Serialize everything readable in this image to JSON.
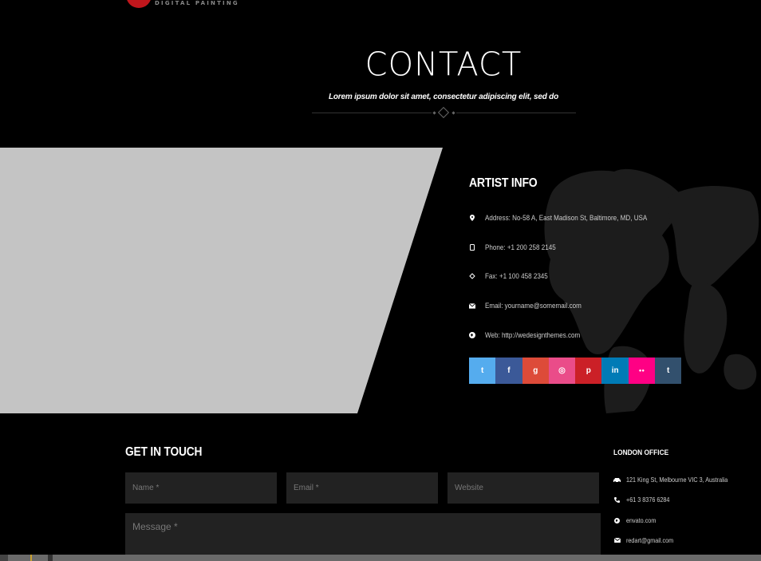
{
  "logo": {
    "subtitle": "DIGITAL PAINTING"
  },
  "header": {
    "title": "CONTACT",
    "subtitle": "Lorem ipsum dolor sit amet, consectetur adipiscing elit, sed do"
  },
  "artist_info": {
    "title": "ARTIST INFO",
    "items": [
      {
        "icon": "map-marker-icon",
        "text": "Address: No-58 A, East Madison St, Baltimore, MD, USA"
      },
      {
        "icon": "phone-icon",
        "text": "Phone: +1 200 258 2145"
      },
      {
        "icon": "fax-icon",
        "text": "Fax: +1 100 458 2345"
      },
      {
        "icon": "envelope-icon",
        "text": "Email: yourname@somemail.com"
      },
      {
        "icon": "globe-icon",
        "text": "Web: http://wedesignthemes.com"
      }
    ],
    "social": [
      {
        "name": "twitter",
        "glyph": "t",
        "color": "#55acee"
      },
      {
        "name": "facebook",
        "glyph": "f",
        "color": "#3b5998"
      },
      {
        "name": "google-plus",
        "glyph": "g",
        "color": "#dd4b39"
      },
      {
        "name": "dribbble",
        "glyph": "◎",
        "color": "#ea4c89"
      },
      {
        "name": "pinterest",
        "glyph": "p",
        "color": "#cb2027"
      },
      {
        "name": "linkedin",
        "glyph": "in",
        "color": "#007bb6"
      },
      {
        "name": "flickr",
        "glyph": "●●",
        "color": "#ff0084"
      },
      {
        "name": "tumblr",
        "glyph": "t",
        "color": "#32506d"
      }
    ]
  },
  "form": {
    "title": "GET IN TOUCH",
    "name_placeholder": "Name *",
    "email_placeholder": "Email *",
    "website_placeholder": "Website",
    "message_placeholder": "Message *"
  },
  "office": {
    "title": "LONDON OFFICE",
    "items": [
      {
        "icon": "car-icon",
        "text": "121 King St, Melbourne VIC 3, Australia"
      },
      {
        "icon": "phone-icon",
        "text": "+61 3 8376 6284"
      },
      {
        "icon": "globe-icon",
        "text": "envato.com"
      },
      {
        "icon": "envelope-icon",
        "text": "redart@gmail.com"
      }
    ]
  }
}
